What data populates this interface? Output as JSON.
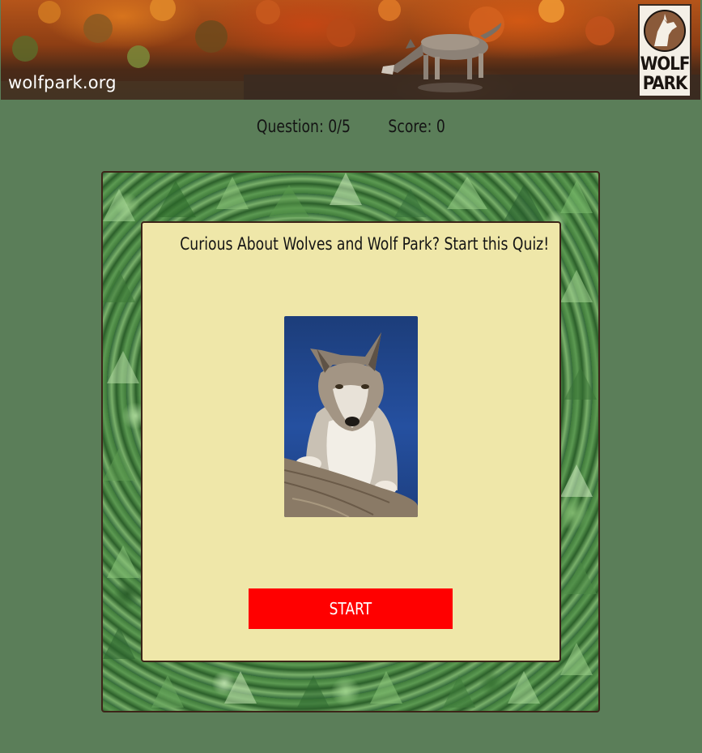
{
  "banner": {
    "site_url": "wolfpark.org",
    "logo_line1": "WOLF",
    "logo_line2": "PARK",
    "image_description": "Gray wolf drinking at water's edge in autumn foliage"
  },
  "stats": {
    "question_label": "Question: 0/5",
    "score_label": "Score: 0"
  },
  "quiz": {
    "title": "Curious About Wolves and Wolf Park? Start this Quiz!",
    "image_alt": "Gray wolf standing on a log against a blue background",
    "start_label": "START"
  },
  "colors": {
    "page_background": "#5b7e59",
    "card_background": "#efe7a9",
    "start_button": "#ff0000",
    "frame_border": "#3c2418"
  }
}
